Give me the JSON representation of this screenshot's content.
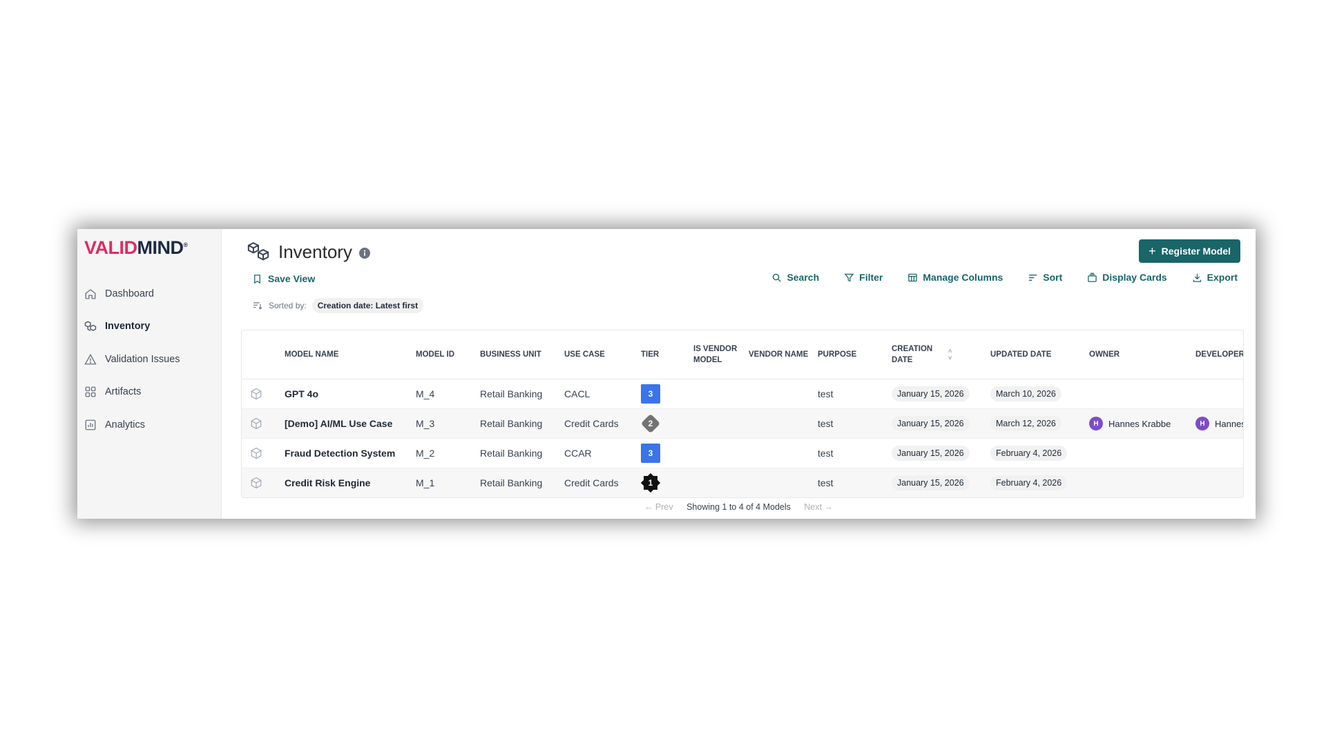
{
  "brand": {
    "logo_part1": "VALID",
    "logo_part2": "MIND",
    "logo_reg": "®"
  },
  "sidebar": {
    "items": [
      {
        "label": "Dashboard",
        "icon": "home-icon"
      },
      {
        "label": "Inventory",
        "icon": "boxes-icon",
        "active": true
      },
      {
        "label": "Validation Issues",
        "icon": "warning-icon"
      },
      {
        "label": "Artifacts",
        "icon": "grid-icon"
      },
      {
        "label": "Analytics",
        "icon": "bar-chart-icon"
      }
    ]
  },
  "header": {
    "title": "Inventory",
    "register_label": "Register Model"
  },
  "toolbar": {
    "save_view": "Save View",
    "search": "Search",
    "filter": "Filter",
    "manage_columns": "Manage Columns",
    "sort": "Sort",
    "display_cards": "Display Cards",
    "export": "Export"
  },
  "sort": {
    "label": "Sorted by:",
    "value": "Creation date: Latest first"
  },
  "table": {
    "headers": {
      "model_name": "MODEL NAME",
      "model_id": "MODEL ID",
      "business_unit": "BUSINESS UNIT",
      "use_case": "USE CASE",
      "tier": "TIER",
      "is_vendor_model": "IS VENDOR MODEL",
      "vendor_name": "VENDOR NAME",
      "purpose": "PURPOSE",
      "creation_date": "CREATION DATE",
      "updated_date": "UPDATED DATE",
      "owner": "OWNER",
      "developer": "DEVELOPER"
    },
    "rows": [
      {
        "name": "GPT 4o",
        "id": "M_4",
        "unit": "Retail Banking",
        "use_case": "CACL",
        "tier": "3",
        "purpose": "test",
        "created": "January 15, 2026",
        "updated": "March 10, 2026",
        "owner": "",
        "owner_initial": "",
        "developer": "",
        "developer_initial": ""
      },
      {
        "name": "[Demo] AI/ML Use Case",
        "id": "M_3",
        "unit": "Retail Banking",
        "use_case": "Credit Cards",
        "tier": "2",
        "purpose": "test",
        "created": "January 15, 2026",
        "updated": "March 12, 2026",
        "owner": "Hannes Krabbe",
        "owner_initial": "H",
        "developer": "Hannes",
        "developer_initial": "H"
      },
      {
        "name": "Fraud Detection System",
        "id": "M_2",
        "unit": "Retail Banking",
        "use_case": "CCAR",
        "tier": "3",
        "purpose": "test",
        "created": "January 15, 2026",
        "updated": "February 4, 2026",
        "owner": "",
        "owner_initial": "",
        "developer": "",
        "developer_initial": ""
      },
      {
        "name": "Credit Risk Engine",
        "id": "M_1",
        "unit": "Retail Banking",
        "use_case": "Credit Cards",
        "tier": "1",
        "purpose": "test",
        "created": "January 15, 2026",
        "updated": "February 4, 2026",
        "owner": "",
        "owner_initial": "",
        "developer": "",
        "developer_initial": ""
      }
    ]
  },
  "pagination": {
    "prev": "← Prev",
    "status": "Showing 1 to 4 of 4 Models",
    "next": "Next →"
  },
  "colors": {
    "accent": "#196568",
    "brand_red": "#de2c62",
    "tier_blue": "#3b74e8",
    "avatar": "#7e4cc9"
  }
}
